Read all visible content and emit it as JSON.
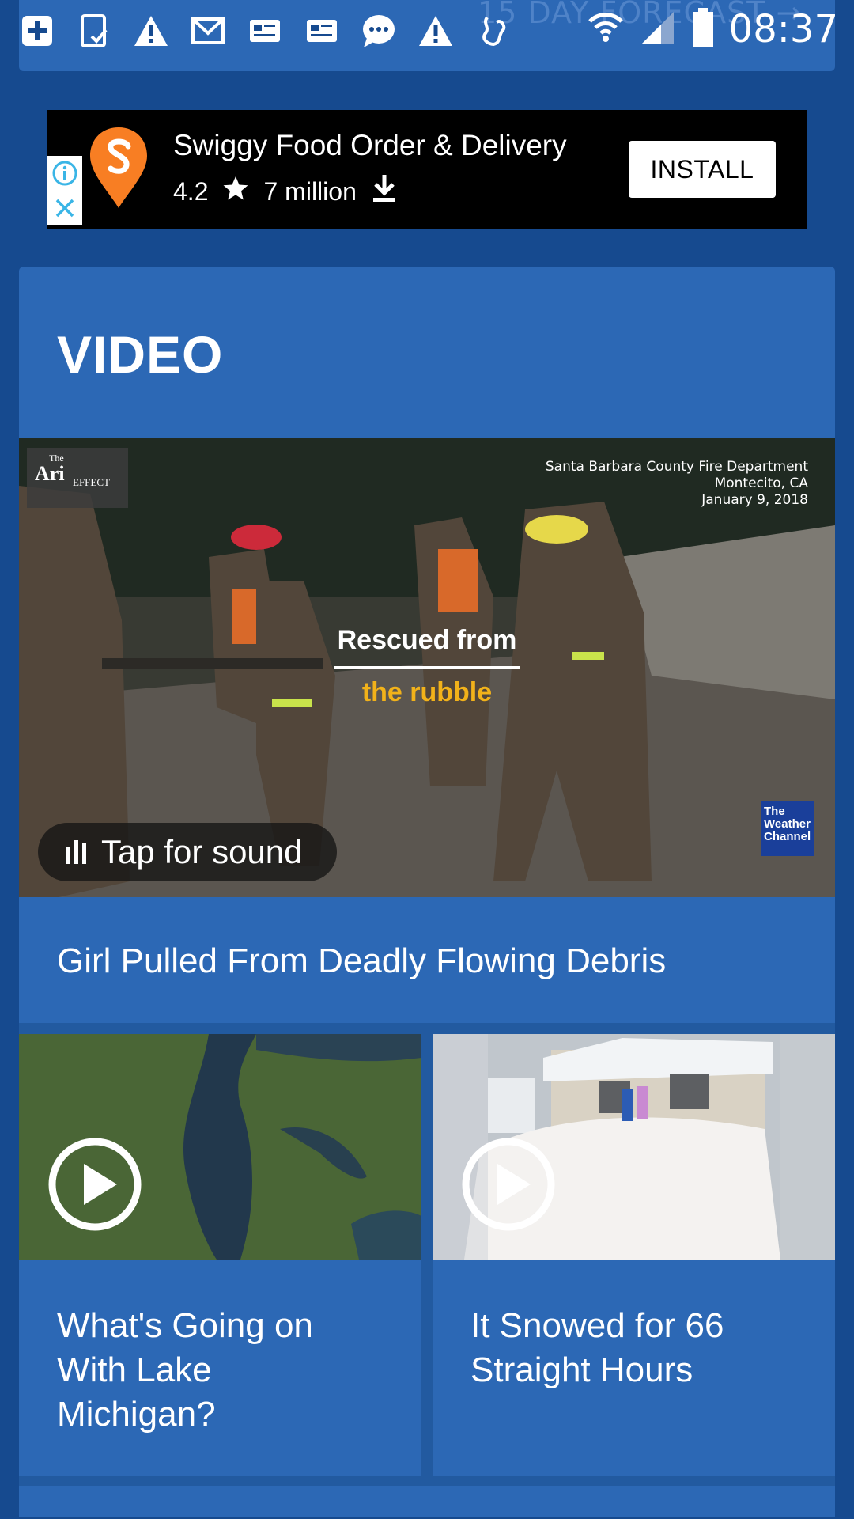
{
  "status_bar": {
    "time": "08:37",
    "behind_text": "15 DAY FORECAST →"
  },
  "ad": {
    "title": "Swiggy Food Order & Delivery",
    "rating": "4.2",
    "downloads": "7 million",
    "install_label": "INSTALL",
    "logo_color": "#f87e23"
  },
  "video_section": {
    "heading": "VIDEO",
    "hero": {
      "logo_text_top": "The",
      "logo_text_main": "Ari",
      "logo_text_sub": "EFFECT",
      "credit_line1": "Santa Barbara County Fire Department",
      "credit_line2": "Montecito, CA",
      "credit_line3": "January 9, 2018",
      "caption_line1": "Rescued from",
      "caption_line2": "the rubble",
      "channel_logo": "The Weather Channel",
      "sound_label": "Tap for sound",
      "title": "Girl Pulled From Deadly Flowing Debris"
    },
    "cards": [
      {
        "title": "What's Going on With Lake Michigan?"
      },
      {
        "title": "It Snowed for 66 Straight Hours"
      }
    ]
  },
  "colors": {
    "background": "#164a8f",
    "card": "#2c68b5",
    "caption_accent": "#f2b21a"
  }
}
